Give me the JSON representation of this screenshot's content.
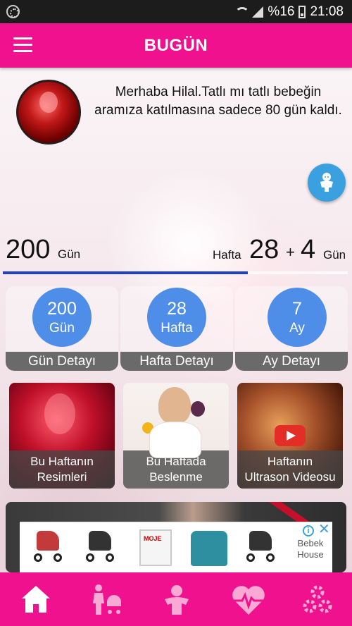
{
  "status_bar": {
    "battery": "%16",
    "time": "21:08"
  },
  "header": {
    "title": "BUGÜN"
  },
  "greeting": {
    "text": "Merhaba Hilal.Tatlı mı tatlı bebeğin aramıza katılmasına sadece 80 gün kaldı."
  },
  "counters": {
    "days_value": "200",
    "days_unit": "Gün",
    "week_label": "Hafta",
    "week_value": "28",
    "plus": "+",
    "extra_days_value": "4",
    "extra_days_unit": "Gün",
    "progress_fraction": 0.71
  },
  "detail_cards": [
    {
      "value": "200",
      "unit": "Gün",
      "label": "Gün Detayı"
    },
    {
      "value": "28",
      "unit": "Hafta",
      "label": "Hafta Detayı"
    },
    {
      "value": "7",
      "unit": "Ay",
      "label": "Ay Detayı"
    }
  ],
  "image_cards": [
    {
      "line1": "Bu Haftanın",
      "line2": "Resimleri"
    },
    {
      "line1": "Bu Haftada",
      "line2": "Beslenme"
    },
    {
      "line1": "Haftanın",
      "line2": "Ultrason Videosu"
    }
  ],
  "ad": {
    "brand_line1": "Bebek",
    "brand_line2": "House",
    "info_icon": "i",
    "close_icon": "✕"
  },
  "bottom_nav": [
    {
      "icon": "home-icon"
    },
    {
      "icon": "mother-stroller-icon"
    },
    {
      "icon": "baby-icon"
    },
    {
      "icon": "heart-pulse-icon"
    },
    {
      "icon": "gears-icon"
    }
  ],
  "colors": {
    "primary": "#f0118f",
    "accent_blue": "#4f8ee8",
    "progress": "#1f3fc8",
    "fab": "#3aa0e0"
  }
}
